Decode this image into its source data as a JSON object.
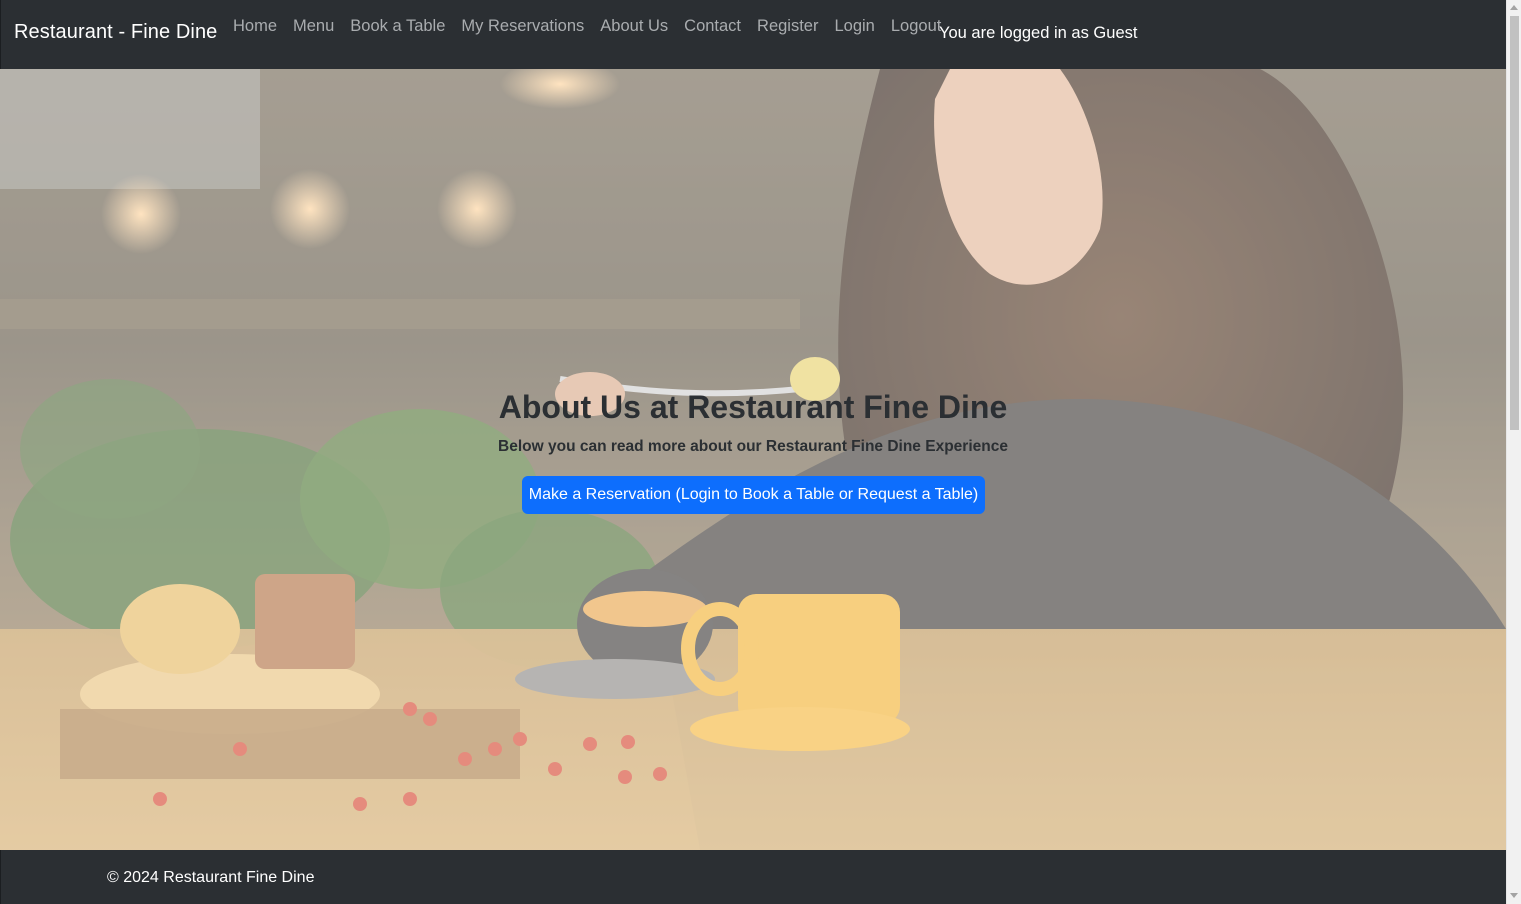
{
  "navbar": {
    "brand": "Restaurant - Fine Dine",
    "links": [
      {
        "label": "Home"
      },
      {
        "label": "Menu"
      },
      {
        "label": "Book a Table"
      },
      {
        "label": "My Reservations"
      },
      {
        "label": "About Us"
      },
      {
        "label": "Contact"
      },
      {
        "label": "Register"
      },
      {
        "label": "Login"
      },
      {
        "label": "Logout"
      }
    ],
    "login_status": "You are logged in as Guest"
  },
  "hero": {
    "title": "About Us at Restaurant Fine Dine",
    "subtitle": "Below you can read more about our Restaurant Fine Dine Experience",
    "button_label": "Make a Reservation (Login to Book a Table or Request a Table)",
    "image_description": "woman-eating-at-restaurant-photo"
  },
  "footer": {
    "text": "© 2024 Restaurant Fine Dine"
  },
  "colors": {
    "navbar_bg": "#2b2f33",
    "nav_link": "#a9acaf",
    "primary_button": "#0d6efd",
    "heading_text": "#2b2f33"
  }
}
